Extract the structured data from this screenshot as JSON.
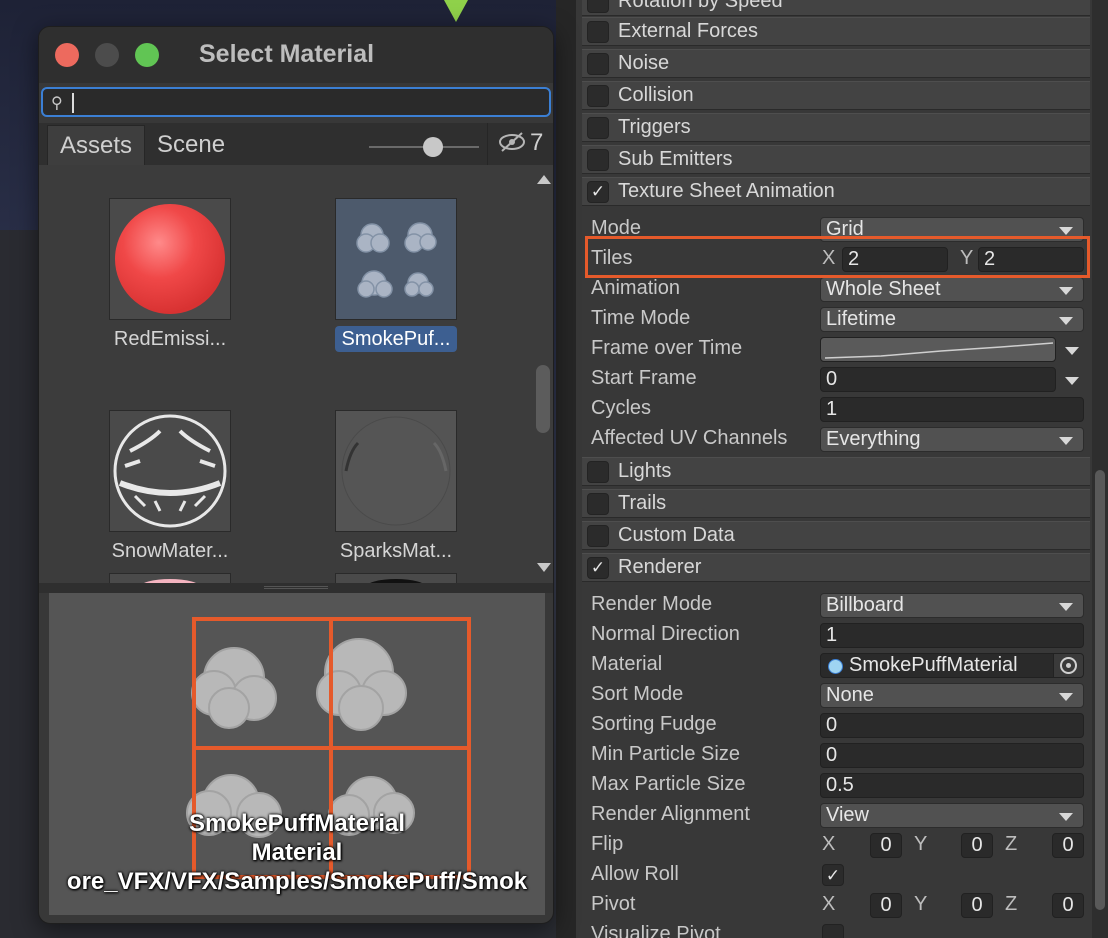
{
  "dialog": {
    "title": "Select Material",
    "search": {
      "value": "",
      "placeholder": ""
    },
    "tabs": [
      {
        "label": "Assets"
      },
      {
        "label": "Scene"
      }
    ],
    "hidden_count": "7",
    "assets": [
      {
        "label": "RedEmissi...",
        "selected": false
      },
      {
        "label": "SmokePuf...",
        "selected": true
      },
      {
        "label": "SnowMater...",
        "selected": false
      },
      {
        "label": "SparksMat...",
        "selected": false
      }
    ],
    "preview": {
      "name": "SmokePuffMaterial",
      "type": "Material",
      "path": "ore_VFX/VFX/Samples/SmokePuff/Smok"
    }
  },
  "inspector": {
    "modules": {
      "rotation_by_speed": {
        "label": "Rotation by Speed",
        "checked": false
      },
      "external_forces": {
        "label": "External Forces",
        "checked": false
      },
      "noise": {
        "label": "Noise",
        "checked": false
      },
      "collision": {
        "label": "Collision",
        "checked": false
      },
      "triggers": {
        "label": "Triggers",
        "checked": false
      },
      "sub_emitters": {
        "label": "Sub Emitters",
        "checked": false
      },
      "texture_sheet": {
        "label": "Texture Sheet Animation",
        "checked": true
      },
      "lights": {
        "label": "Lights",
        "checked": false
      },
      "trails": {
        "label": "Trails",
        "checked": false
      },
      "custom_data": {
        "label": "Custom Data",
        "checked": false
      },
      "renderer": {
        "label": "Renderer",
        "checked": true
      }
    },
    "texture_sheet": {
      "mode": {
        "label": "Mode",
        "value": "Grid"
      },
      "tiles": {
        "label": "Tiles",
        "x_label": "X",
        "x": "2",
        "y_label": "Y",
        "y": "2"
      },
      "animation": {
        "label": "Animation",
        "value": "Whole Sheet"
      },
      "time_mode": {
        "label": "Time Mode",
        "value": "Lifetime"
      },
      "frame_over_time": {
        "label": "Frame over Time"
      },
      "start_frame": {
        "label": "Start Frame",
        "value": "0"
      },
      "cycles": {
        "label": "Cycles",
        "value": "1"
      },
      "uv_channels": {
        "label": "Affected UV Channels",
        "value": "Everything"
      }
    },
    "renderer": {
      "render_mode": {
        "label": "Render Mode",
        "value": "Billboard"
      },
      "normal_direction": {
        "label": "Normal Direction",
        "value": "1"
      },
      "material": {
        "label": "Material",
        "value": "SmokePuffMaterial"
      },
      "sort_mode": {
        "label": "Sort Mode",
        "value": "None"
      },
      "sorting_fudge": {
        "label": "Sorting Fudge",
        "value": "0"
      },
      "min_particle_size": {
        "label": "Min Particle Size",
        "value": "0"
      },
      "max_particle_size": {
        "label": "Max Particle Size",
        "value": "0.5"
      },
      "render_alignment": {
        "label": "Render Alignment",
        "value": "View"
      },
      "flip": {
        "label": "Flip",
        "x_label": "X",
        "x": "0",
        "y_label": "Y",
        "y": "0",
        "z_label": "Z",
        "z": "0"
      },
      "allow_roll": {
        "label": "Allow Roll",
        "checked": true
      },
      "pivot": {
        "label": "Pivot",
        "x_label": "X",
        "x": "0",
        "y_label": "Y",
        "y": "0",
        "z_label": "Z",
        "z": "0"
      },
      "visualize_pivot": {
        "label": "Visualize Pivot"
      }
    }
  },
  "colors": {
    "highlight": "#e55a2b",
    "selection": "#3d5f91",
    "search_focus": "#3b7fd4"
  }
}
